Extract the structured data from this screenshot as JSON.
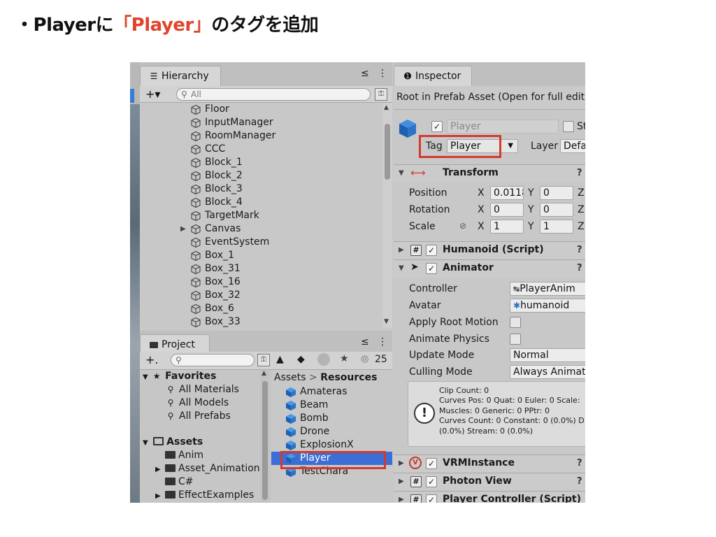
{
  "slide": {
    "bullet": "・",
    "title_pre": "Playerに",
    "title_accent": "「Player」",
    "title_post": "のタグを追加"
  },
  "hierarchy": {
    "tab_label": "Hierarchy",
    "tab_actions": "≤ ⋮",
    "add_label": "+▾",
    "search_placeholder": "All",
    "items": [
      {
        "name": "Floor",
        "expander": ""
      },
      {
        "name": "InputManager",
        "expander": ""
      },
      {
        "name": "RoomManager",
        "expander": ""
      },
      {
        "name": "CCC",
        "expander": ""
      },
      {
        "name": "Block_1",
        "expander": ""
      },
      {
        "name": "Block_2",
        "expander": ""
      },
      {
        "name": "Block_3",
        "expander": ""
      },
      {
        "name": "Block_4",
        "expander": ""
      },
      {
        "name": "TargetMark",
        "expander": ""
      },
      {
        "name": "Canvas",
        "expander": "▶"
      },
      {
        "name": "EventSystem",
        "expander": ""
      },
      {
        "name": "Box_1",
        "expander": ""
      },
      {
        "name": "Box_31",
        "expander": ""
      },
      {
        "name": "Box_16",
        "expander": ""
      },
      {
        "name": "Box_32",
        "expander": ""
      },
      {
        "name": "Box_6",
        "expander": ""
      },
      {
        "name": "Box_33",
        "expander": ""
      }
    ]
  },
  "project": {
    "tab_label": "Project",
    "tab_actions": "≤ ⋮",
    "add_label": "+.",
    "hidden_count": "25",
    "favorites": {
      "label": "Favorites",
      "items": [
        "All Materials",
        "All Models",
        "All Prefabs"
      ]
    },
    "assets": {
      "label": "Assets",
      "folders": [
        {
          "name": "Anim",
          "expander": ""
        },
        {
          "name": "Asset_Animation",
          "expander": "▶"
        },
        {
          "name": "C#",
          "expander": ""
        },
        {
          "name": "EffectExamples",
          "expander": "▶"
        }
      ]
    },
    "breadcrumb": {
      "root": "Assets",
      "separator": ">",
      "current": "Resources"
    },
    "resources": [
      "Amateras",
      "Beam",
      "Bomb",
      "Drone",
      "ExplosionX",
      "Player",
      "TestChara"
    ],
    "selected": "Player"
  },
  "inspector": {
    "tab_label": "Inspector",
    "root_notice": "Root in Prefab Asset (Open for full editin",
    "object_name": "Player",
    "static_label": "St",
    "tag_label": "Tag",
    "tag_value": "Player",
    "layer_label": "Layer",
    "layer_value": "Defa",
    "transform": {
      "name": "Transform",
      "position": {
        "label": "Position",
        "x": "0.0118",
        "y": "0",
        "z": "Z"
      },
      "rotation": {
        "label": "Rotation",
        "x": "0",
        "y": "0",
        "z": "Z"
      },
      "scale": {
        "label": "Scale",
        "x": "1",
        "y": "1",
        "z": "Z"
      },
      "x_label": "X",
      "y_label": "Y"
    },
    "humanoid": {
      "name": "Humanoid (Script)"
    },
    "animator": {
      "name": "Animator",
      "controller_label": "Controller",
      "controller_value": "PlayerAnim",
      "avatar_label": "Avatar",
      "avatar_value": "humanoid",
      "apply_root_motion_label": "Apply Root Motion",
      "animate_physics_label": "Animate Physics",
      "update_mode_label": "Update Mode",
      "update_mode_value": "Normal",
      "culling_mode_label": "Culling Mode",
      "culling_mode_value": "Always Animate",
      "info_text": "Clip Count: 0\nCurves Pos: 0 Quat: 0 Euler: 0 Scale:\nMuscles: 0 Generic: 0 PPtr: 0\nCurves Count: 0 Constant: 0 (0.0%) D\n(0.0%) Stream: 0 (0.0%)"
    },
    "vrm": {
      "name": "VRMInstance"
    },
    "photon": {
      "name": "Photon View"
    },
    "player_controller": {
      "name": "Player Controller (Script)"
    }
  },
  "colors": {
    "accent": "#e0452c",
    "highlight_box": "#d33a2c",
    "selection": "#3b6fd6",
    "panel": "#c8c8c8"
  }
}
